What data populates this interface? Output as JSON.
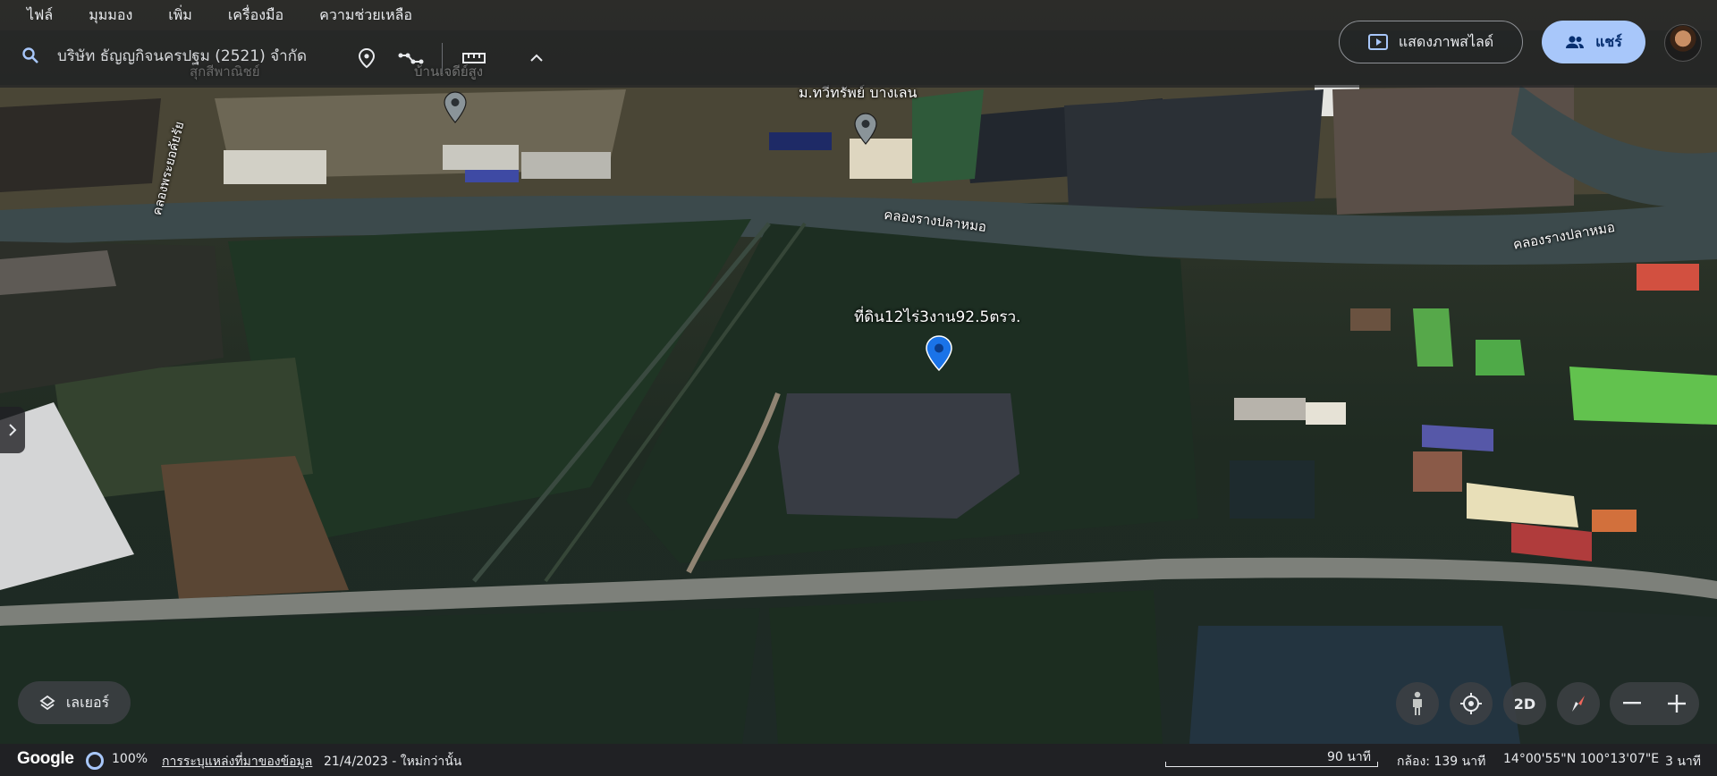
{
  "menu": {
    "items": [
      "ไฟล์",
      "มุมมอง",
      "เพิ่ม",
      "เครื่องมือ",
      "ความช่วยเหลือ"
    ]
  },
  "search": {
    "value": "บริษัท ธัญญกิจนครปฐม (2521) จำกัด",
    "icon": "search-icon"
  },
  "toolbar_icons": [
    "place-pin-icon",
    "path-icon",
    "ruler-icon",
    "chevron-up-icon"
  ],
  "header": {
    "slideshow_label": "แสดงภาพสไลด์",
    "share_label": "แชร์"
  },
  "map": {
    "labels": {
      "village": "ม.ทวีทรัพย์ บางเลน",
      "canal_main_1": "คลองรางปลาหมอ",
      "canal_main_2": "คลองรางปลาหมอ",
      "canal_left": "คลองพระยอคัยรัย",
      "pin_label": "ที่ดิน12ไร่3งาน92.5ตรว.",
      "faded_1": "บ้านเจดีย์สูง",
      "faded_2": "สุกสีพาณิชย์"
    },
    "colors": {
      "selected_pin": "#1a73e8",
      "gray_pin": "#8a9499"
    }
  },
  "controls": {
    "layers_label": "เลเยอร์",
    "view_2d_label": "2D"
  },
  "status": {
    "brand": "Google",
    "load_percent": "100%",
    "data_sources_link": "การระบุแหล่งที่มาของข้อมูล",
    "imagery_date": "21/4/2023 - ใหม่กว่านั้น",
    "scale": "90 นาที",
    "camera": "กล้อง: 139 นาที",
    "coordinates": "14°00'55\"N 100°13'07\"E",
    "eye_alt": "3 นาที"
  }
}
